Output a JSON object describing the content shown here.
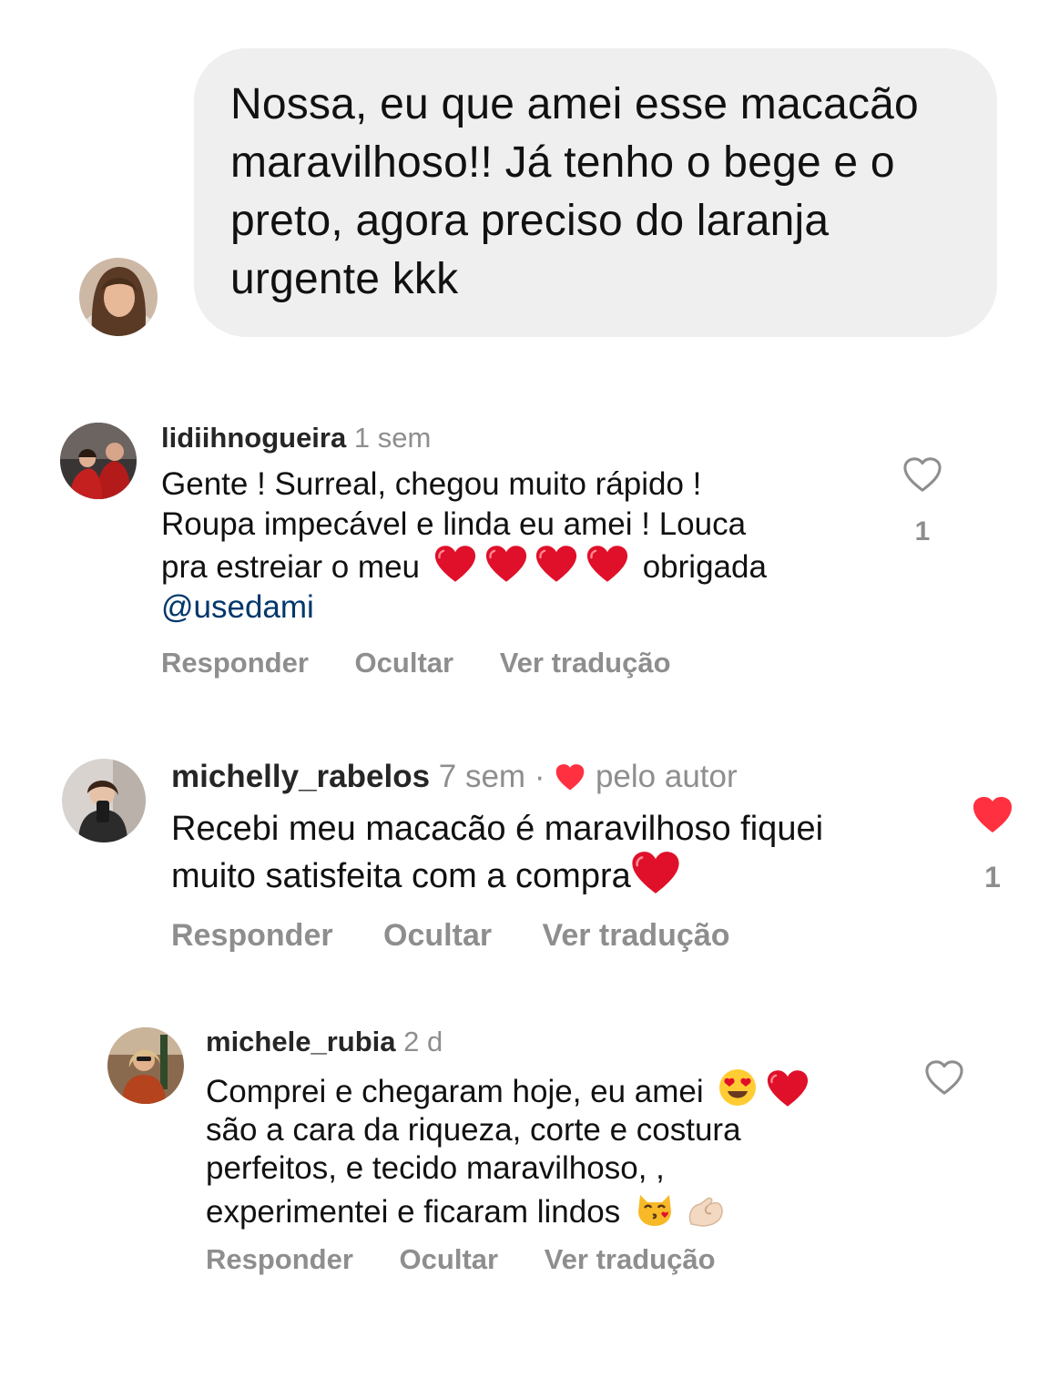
{
  "message": {
    "lines": [
      "Nossa, eu que amei esse macacão",
      "maravilhoso!! Já tenho o bege e o",
      "preto, agora preciso do laranja",
      "urgente kkk"
    ]
  },
  "comments": [
    {
      "username": "lidiihnogueira",
      "time": "1 sem",
      "line1": "Gente ! Surreal, chegou muito rápido !",
      "line2": "Roupa impecável e linda eu amei ! Louca",
      "line3_pre": "pra estreiar o meu",
      "line3_post": "obrigada",
      "mention": "@usedami",
      "emojis": [
        "red-heart",
        "red-heart",
        "red-heart",
        "red-heart"
      ],
      "likes": "1",
      "liked": false,
      "actions": {
        "reply": "Responder",
        "hide": "Ocultar",
        "translate": "Ver tradução"
      }
    },
    {
      "username": "michelly_rabelos",
      "time": "7 sem",
      "separator": "·",
      "author_label": "pelo autor",
      "line1": "Recebi meu macacão é maravilhoso fiquei",
      "line2": "muito satisfeita com a compra",
      "emojis": [
        "red-heart"
      ],
      "likes": "1",
      "liked": true,
      "actions": {
        "reply": "Responder",
        "hide": "Ocultar",
        "translate": "Ver tradução"
      }
    },
    {
      "username": "michele_rubia",
      "time": "2 d",
      "line1": "Comprei e chegaram hoje, eu amei",
      "line2": "são a cara da riqueza, corte e costura",
      "line3": "perfeitos, e tecido maravilhoso, ,",
      "line4": "experimentei e ficaram lindos",
      "emojis": [
        "heart-eyes",
        "red-heart",
        "kissing-cat",
        "pinching-hand"
      ],
      "likes": "",
      "liked": false,
      "actions": {
        "reply": "Responder",
        "hide": "Ocultar",
        "translate": "Ver tradução"
      }
    }
  ],
  "colors": {
    "bubble": "#efefef",
    "heart_red": "#ff3040",
    "mention": "#00376b",
    "muted": "#8e8e8e"
  }
}
